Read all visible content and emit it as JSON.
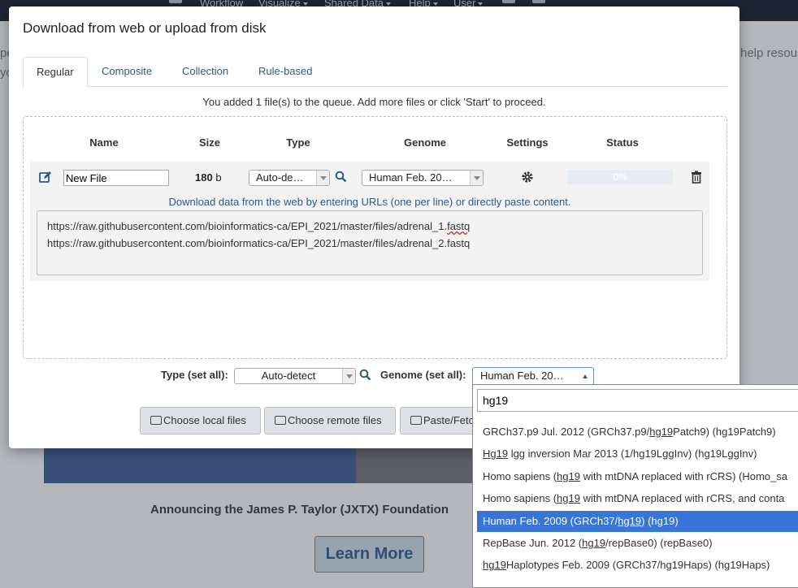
{
  "navbar": {
    "items": [
      {
        "label": "Workflow"
      },
      {
        "label": "Visualize"
      },
      {
        "label": "Shared Data"
      },
      {
        "label": "Help"
      },
      {
        "label": "User"
      }
    ]
  },
  "background": {
    "left_text_1": "pe",
    "left_text_2": "yo",
    "right_text": "help resou",
    "announcement": "Announcing the James P. Taylor (JXTX) Foundation",
    "learn_more": "Learn More"
  },
  "modal": {
    "title": "Download from web or upload from disk",
    "tabs": [
      {
        "label": "Regular"
      },
      {
        "label": "Composite"
      },
      {
        "label": "Collection"
      },
      {
        "label": "Rule-based"
      }
    ],
    "queue_message": "You added 1 file(s) to the queue. Add more files or click 'Start' to proceed.",
    "columns": {
      "name": "Name",
      "size": "Size",
      "type": "Type",
      "genome": "Genome",
      "settings": "Settings",
      "status": "Status"
    },
    "row": {
      "name_value": "New File",
      "size_value": "180",
      "size_unit": "b",
      "type_value": "Auto-de…",
      "genome_value": "Human Feb. 20…",
      "status_progress": "0%"
    },
    "url_help": "Download data from the web by entering URLs (one per line) or directly paste content.",
    "urls": {
      "line1_before": "https://raw.githubusercontent.com/bioinformatics-ca/EPI_2021/master/files/adrenal_1.",
      "line1_mark": "fastq",
      "line2": "https://raw.githubusercontent.com/bioinformatics-ca/EPI_2021/master/files/adrenal_2.fastq"
    },
    "set_all": {
      "type_label": "Type (set all):",
      "type_value": "Auto-detect",
      "genome_label": "Genome (set all):",
      "genome_value": "Human Feb. 20…"
    },
    "buttons": {
      "choose_local": "Choose local files",
      "choose_remote": "Choose remote files",
      "paste_fetch": "Paste/Fetc"
    }
  },
  "genome_dropdown": {
    "search_value": "hg19",
    "items": [
      {
        "pre": "GRCh37.p9 Jul. 2012 (GRCh37.p9/",
        "hl": "hg19",
        "post": "Patch9) (hg19Patch9)"
      },
      {
        "pre": "",
        "hl": "Hg19",
        "post": " lgg inversion Mar 2013 (1/hg19LggInv) (hg19LggInv)"
      },
      {
        "pre": "Homo sapiens (",
        "hl": "hg19",
        "post": " with mtDNA replaced with rCRS) (Homo_sa"
      },
      {
        "pre": "Homo sapiens (",
        "hl": "hg19",
        "post": " with mtDNA replaced with rCRS, and conta"
      },
      {
        "pre": "Human Feb. 2009 (GRCh37/",
        "hl": "hg19",
        "post": ") (hg19)"
      },
      {
        "pre": "RepBase Jun. 2012 (",
        "hl": "hg19",
        "post": "/repBase0) (repBase0)"
      },
      {
        "pre": "",
        "hl": "hg19",
        "post": "Haplotypes Feb. 2009 (GRCh37/hg19Haps) (hg19Haps)"
      }
    ],
    "selected_index": 4
  },
  "colors": {
    "link": "#2c5a88",
    "selected": "#3875d7",
    "navbar": "#1e2535"
  }
}
